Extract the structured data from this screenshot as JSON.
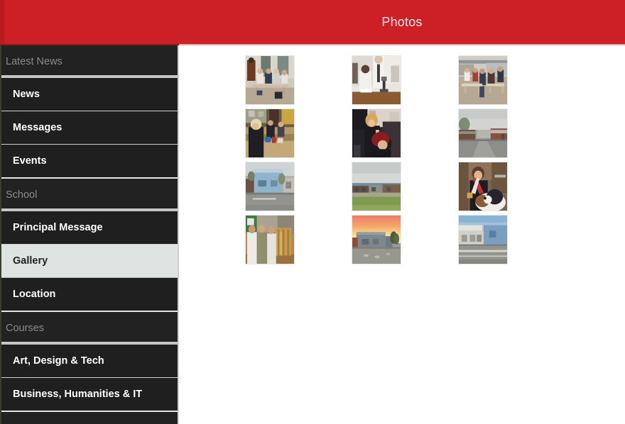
{
  "header": {
    "title": "Photos"
  },
  "sidebar": {
    "groups": [
      {
        "header": "Latest News",
        "items": [
          {
            "label": "News",
            "selected": false
          },
          {
            "label": "Messages",
            "selected": false
          },
          {
            "label": "Events",
            "selected": false
          }
        ]
      },
      {
        "header": "School",
        "items": [
          {
            "label": "Principal Message",
            "selected": false
          },
          {
            "label": "Gallery",
            "selected": true
          },
          {
            "label": "Location",
            "selected": false
          }
        ]
      },
      {
        "header": "Courses",
        "items": [
          {
            "label": "Art, Design & Tech",
            "selected": false
          },
          {
            "label": "Business, Humanities & IT",
            "selected": false
          }
        ]
      }
    ]
  },
  "gallery": {
    "columns": 3,
    "rows": 4,
    "photos": [
      {
        "name": "students-outdoor-picnic-tables",
        "alt": "Students sitting at outdoor picnic tables by a building"
      },
      {
        "name": "engineering-lab-microscope",
        "alt": "Two men working with equipment in a laboratory"
      },
      {
        "name": "courtyard-seating-crowd",
        "alt": "Crowd of students seated in a paved courtyard"
      },
      {
        "name": "art-workshop-classroom",
        "alt": "Students working at benches in an art and design workshop"
      },
      {
        "name": "hairdressing-salon-styling",
        "alt": "Hairdresser styling a client's red hair in a salon"
      },
      {
        "name": "campus-street-view-cloudy",
        "alt": "Campus roadway with low buildings under a cloudy sky"
      },
      {
        "name": "blue-campus-building-exterior",
        "alt": "Blue clad campus building seen from the car park"
      },
      {
        "name": "campus-building-green-field",
        "alt": "Long campus building behind a green grass field"
      },
      {
        "name": "woman-with-dog-indoors",
        "alt": "Smiling woman holding a black and white dog indoors"
      },
      {
        "name": "woodworking-students-staircase",
        "alt": "Three students examining a timber staircase in a workshop"
      },
      {
        "name": "campus-building-sunset-sky",
        "alt": "Campus building silhouetted against a pink sunset sky"
      },
      {
        "name": "modern-campus-entrance-blue-sky",
        "alt": "Modern campus entrance building under a blue sky"
      }
    ]
  },
  "colors": {
    "header_red": "#cc2026",
    "sidebar_dark": "#222222",
    "sidebar_selected": "#dfe3e2",
    "sidebar_header_text": "#8a8a8a",
    "content_bg": "#ffffff"
  }
}
